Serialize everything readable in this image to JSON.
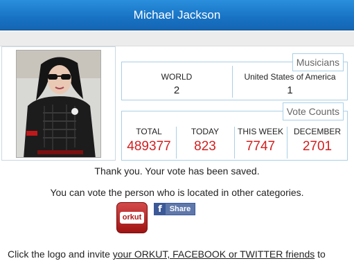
{
  "header": {
    "title": "Michael Jackson"
  },
  "musicians": {
    "title": "Musicians",
    "columns": [
      {
        "label": "WORLD",
        "value": "2"
      },
      {
        "label": "United States of America",
        "value": "1"
      }
    ]
  },
  "votes": {
    "title": "Vote Counts",
    "columns": [
      {
        "label": "TOTAL",
        "value": "489377"
      },
      {
        "label": "TODAY",
        "value": "823"
      },
      {
        "label": "THIS WEEK",
        "value": "7747"
      },
      {
        "label": "DECEMBER",
        "value": "2701"
      }
    ]
  },
  "messages": {
    "saved": "Thank you. Your vote has been saved.",
    "other": "You can vote the person who is located in other categories.",
    "invite_prefix": "Click the logo and invite ",
    "invite_link": "your ORKUT, FACEBOOK or TWITTER friends",
    "invite_suffix": " to"
  },
  "social": {
    "orkut_label": "orkut",
    "fb_icon": "f",
    "fb_share_label": "Share"
  },
  "colors": {
    "header": "#1872c4",
    "vote_value": "#d21e1e",
    "box_border": "#a9cfe6"
  }
}
